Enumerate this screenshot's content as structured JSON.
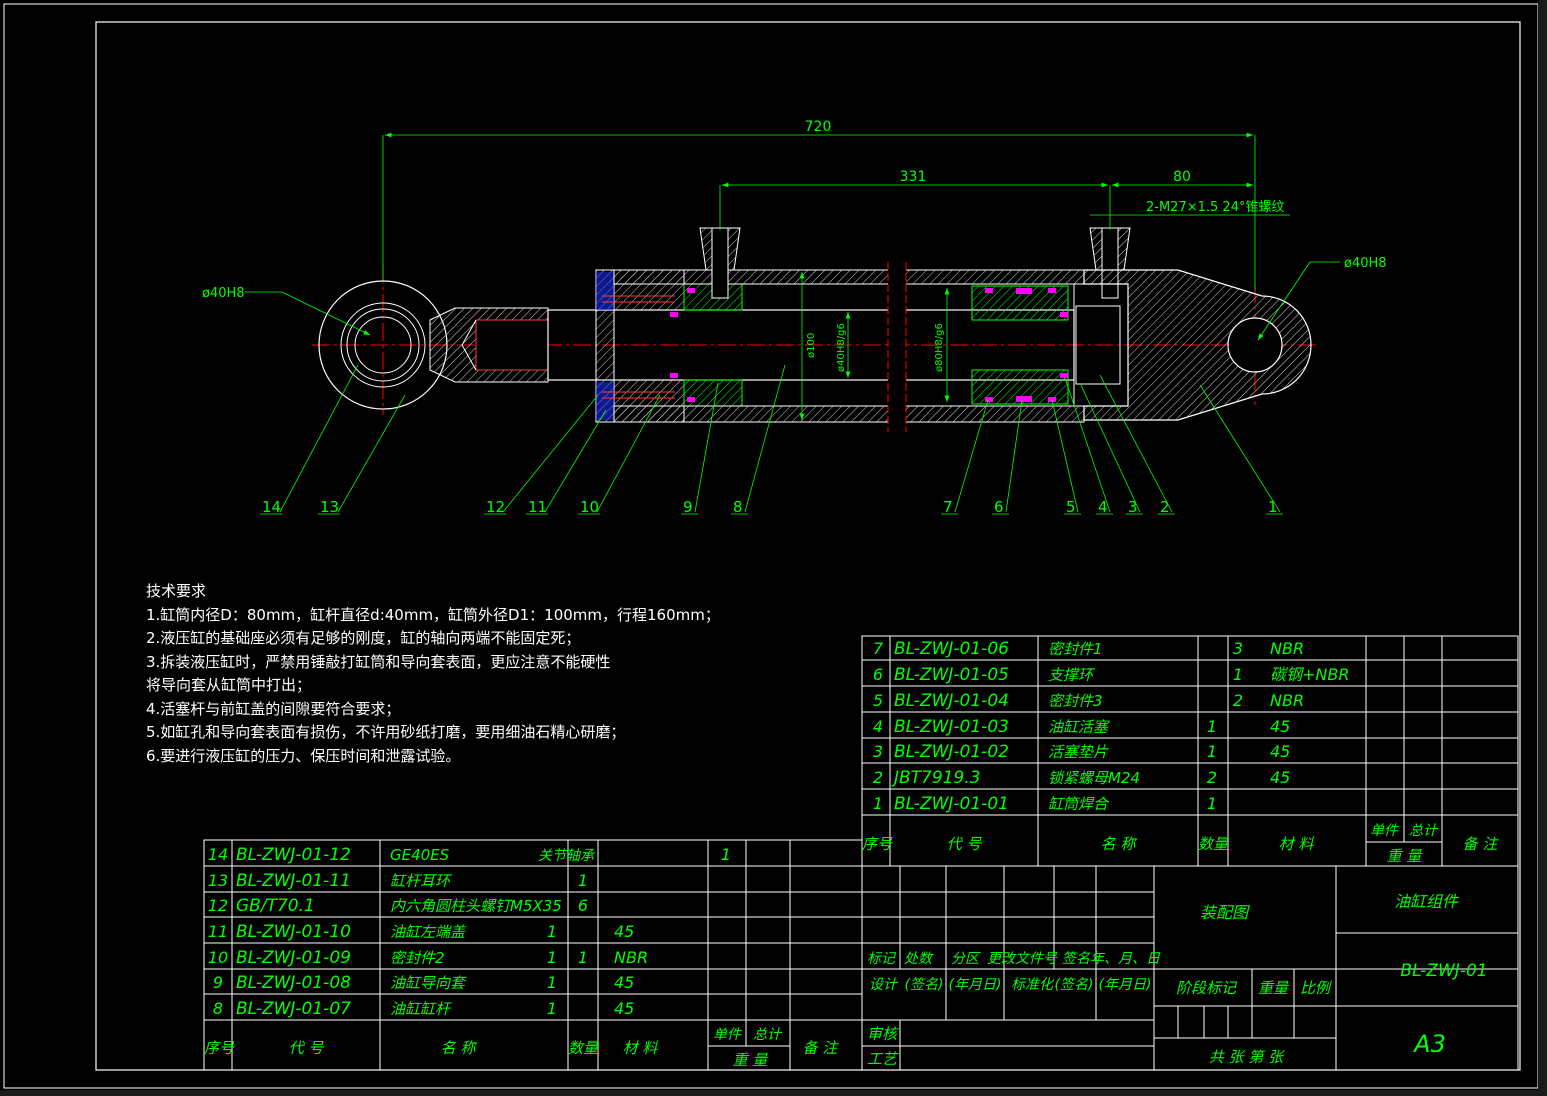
{
  "colors": {
    "background": "#000000",
    "frame": "#ffffff",
    "part": "#00ff00",
    "centerline": "#ff0000",
    "seal": "#ff00ff",
    "bolt": "#3a5bff",
    "hatch": "#ffffff",
    "dimension": "#00ff00"
  },
  "dimensions": {
    "overall_length": "720",
    "port_distance": "331",
    "port_to_end": "80",
    "port_thread": "2-M27×1.5 24°锥螺纹",
    "left_eye_bore": "ø40H8",
    "right_eye_bore": "ø40H8",
    "tube_od": "ø100",
    "rod_fit": "ø40H8/g6",
    "bore_fit": "ø80H8/g6"
  },
  "balloons": [
    "14",
    "13",
    "12",
    "11",
    "10",
    "9",
    "8",
    "7",
    "6",
    "5",
    "4",
    "3",
    "2",
    "1"
  ],
  "notes": {
    "title": "技术要求",
    "items": [
      "1.缸筒内径D：80mm，缸杆直径d:40mm，缸筒外径D1：100mm，行程160mm；",
      "2.液压缸的基础座必须有足够的刚度，缸的轴向两端不能固定死；",
      "3.拆装液压缸时，严禁用锤敲打缸筒和导向套表面，更应注意不能硬性",
      "将导向套从缸筒中打出；",
      "4.活塞杆与前缸盖的间隙要符合要求；",
      "5.如缸孔和导向套表面有损伤，不许用砂纸打磨，要用细油石精心研磨；",
      "6.要进行液压缸的压力、保压时间和泄露试验。"
    ]
  },
  "bom_right": {
    "rows": [
      {
        "no": "7",
        "code": "BL-ZWJ-01-06",
        "name": "密封件1",
        "qty": "",
        "mat_qty": "3",
        "material": "NBR"
      },
      {
        "no": "6",
        "code": "BL-ZWJ-01-05",
        "name": "支撑环",
        "qty": "",
        "mat_qty": "1",
        "material": "碳钢+NBR"
      },
      {
        "no": "5",
        "code": "BL-ZWJ-01-04",
        "name": "密封件3",
        "qty": "",
        "mat_qty": "2",
        "material": "NBR"
      },
      {
        "no": "4",
        "code": "BL-ZWJ-01-03",
        "name": "油缸活塞",
        "qty": "1",
        "mat_qty": "",
        "material": "45"
      },
      {
        "no": "3",
        "code": "BL-ZWJ-01-02",
        "name": "活塞垫片",
        "qty": "1",
        "mat_qty": "",
        "material": "45"
      },
      {
        "no": "2",
        "code": "JBT7919.3",
        "name": "锁紧螺母M24",
        "qty": "2",
        "mat_qty": "",
        "material": "45"
      },
      {
        "no": "1",
        "code": "BL-ZWJ-01-01",
        "name": "缸筒焊合",
        "qty": "1",
        "mat_qty": "",
        "material": ""
      }
    ],
    "header": {
      "no": "序号",
      "code": "代 号",
      "name": "名 称",
      "qty": "数量",
      "material": "材 料",
      "unit": "单件",
      "total": "总计",
      "weight": "重 量",
      "remark": "备 注"
    }
  },
  "bom_left": {
    "rows": [
      {
        "no": "14",
        "code": "BL-ZWJ-01-12",
        "name": "GE40ES",
        "name2": "关节轴承",
        "qty": "",
        "material": "",
        "extra": "1"
      },
      {
        "no": "13",
        "code": "BL-ZWJ-01-11",
        "name": "缸杆耳环",
        "name2": "",
        "qty": "1",
        "material": "",
        "extra": ""
      },
      {
        "no": "12",
        "code": "GB/T70.1",
        "name": "内六角圆柱头螺钉M5X35",
        "name2": "",
        "qty": "6",
        "material": "",
        "extra": ""
      },
      {
        "no": "11",
        "code": "BL-ZWJ-01-10",
        "name": "油缸左端盖",
        "name2": "",
        "qty": "1",
        "material": "45",
        "extra": ""
      },
      {
        "no": "10",
        "code": "BL-ZWJ-01-09",
        "name": "密封件2",
        "name2": "",
        "qty": "1",
        "material": "NBR",
        "extra": ""
      },
      {
        "no": "9",
        "code": "BL-ZWJ-01-08",
        "name": "油缸导向套",
        "name2": "",
        "qty": "1",
        "material": "45",
        "extra": ""
      },
      {
        "no": "8",
        "code": "BL-ZWJ-01-07",
        "name": "油缸缸杆",
        "name2": "",
        "qty": "1",
        "material": "45",
        "extra": ""
      }
    ],
    "header": {
      "no": "序号",
      "code": "代 号",
      "name": "名 称",
      "qty": "数量",
      "material": "材 料",
      "unit": "单件",
      "total": "总计",
      "weight": "重 量",
      "remark": "备 注"
    }
  },
  "title_block": {
    "drawing_type": "装配图",
    "drawing_name": "油缸组件",
    "drawing_code": "BL-ZWJ-01",
    "sheet_size": "A3",
    "rev_row": [
      "标记",
      "处数",
      "分区",
      "更改文件号",
      "签名",
      "年、月、日"
    ],
    "design_row": [
      "设计",
      "(签名)",
      "(年月日)",
      "标准化",
      "(签名)",
      "(年月日)"
    ],
    "stage": "阶段标记",
    "weight": "重量",
    "scale": "比例",
    "review": "审核",
    "process": "工艺",
    "sheets": "共    张  第    张"
  }
}
